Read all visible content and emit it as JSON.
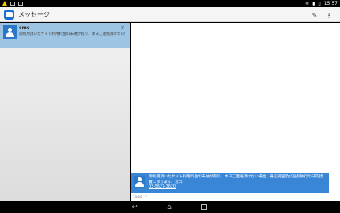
{
  "status": {
    "time": "15:57"
  },
  "app": {
    "title": "メッセージ"
  },
  "conversation": {
    "name": "sms",
    "snippet": "御利用頂いたサイト利用料金の未納が有り、本日ご連絡頂けない場合、身辺調査及び強制執行の法的措置に移ります。窓口",
    "close": "×"
  },
  "message": {
    "text": "御利用頂いたサイト利用料金の未納が有り、本日ご連絡頂けない場合、身辺調査及び強制執行の法的措置に移ります。窓口",
    "phone": "03-5627-3620",
    "time": "13:26"
  },
  "icons": {
    "warning": "warning-icon",
    "new_message": "new-message-icon",
    "overflow": "overflow-menu-icon",
    "back": "back-icon",
    "home": "home-icon",
    "recent": "recent-apps-icon"
  },
  "colors": {
    "accent": "#3a86d6",
    "selected": "#9dc4e2",
    "avatar": "#2b78c8"
  }
}
